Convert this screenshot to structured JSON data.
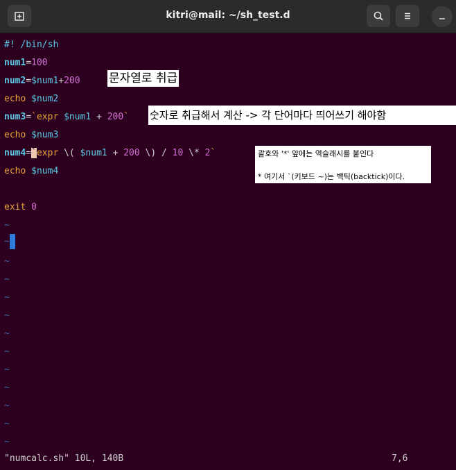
{
  "window": {
    "title": "kitri@mail: ~/sh_test.d",
    "new_tab_icon": "new-tab-icon",
    "search_icon": "search-icon",
    "menu_icon": "hamburger-menu-icon",
    "minimize_icon": "minimize-icon"
  },
  "code": {
    "line1": "#! /bin/sh",
    "line2_var": "num1",
    "line2_eq": "=",
    "line2_val": "100",
    "line3_var": "num2",
    "line3_eq": "=",
    "line3_ref": "$num1",
    "line3_plus": "+",
    "line3_val": "200",
    "line4_kw": "echo",
    "line4_ref": "$num2",
    "line5_var": "num3",
    "line5_eq": "=",
    "line5_bt1": "`",
    "line5_expr": "expr",
    "line5_ref": "$num1",
    "line5_plus": "+",
    "line5_val": "200",
    "line5_bt2": "`",
    "line6_kw": "echo",
    "line6_ref": "$num3",
    "line7_var": "num4",
    "line7_eq": "=",
    "line7_bt1": "`",
    "line7_expr": "expr",
    "line7_lp": "\\(",
    "line7_ref": "$num1",
    "line7_plus": "+",
    "line7_val": "200",
    "line7_rp": "\\)",
    "line7_div": "/",
    "line7_ten": "10",
    "line7_mul": "\\*",
    "line7_two": "2",
    "line7_bt2": "`",
    "line8_kw": "echo",
    "line8_ref": "$num4",
    "line10_kw": "exit",
    "line10_val": "0",
    "tilde": "~"
  },
  "status": {
    "file": "\"numcalc.sh\" 10L, 140B",
    "position": "7,6"
  },
  "annotations": {
    "a1": "문자열로 취급",
    "a2": "숫자로 취급해서 계산 -> 각 단어마다 띄어쓰기 해야함",
    "a3_line1": "괄호와 '*' 앞에는 역슬래시를 붙인다",
    "a3_line2": "* 여기서 `(키보드 ~)는 백틱(backtick)이다."
  },
  "colors": {
    "background": "#2c001e",
    "keyword": "#e8a63a",
    "variable": "#5ec8e6",
    "number": "#d36fd6",
    "tilde": "#3f6cb0",
    "cursor": "#2f7ad6"
  }
}
